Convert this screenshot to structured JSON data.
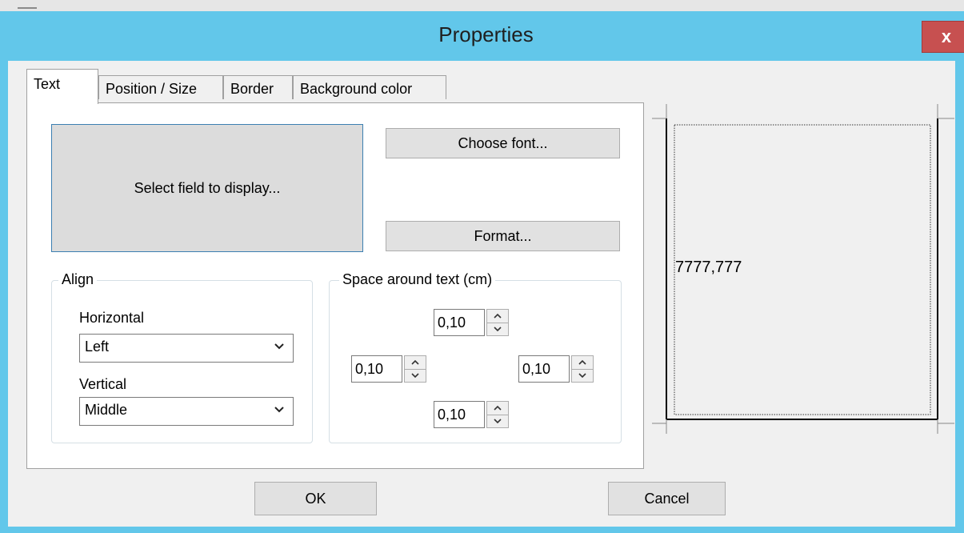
{
  "window": {
    "title": "Properties",
    "close_label": "x"
  },
  "tabs": [
    {
      "label": "Text",
      "active": true
    },
    {
      "label": "Position / Size",
      "active": false
    },
    {
      "label": "Border",
      "active": false
    },
    {
      "label": "Background color",
      "active": false
    }
  ],
  "text_tab": {
    "select_field_label": "Select field to display...",
    "choose_font_label": "Choose font...",
    "format_label": "Format...",
    "align": {
      "legend": "Align",
      "horizontal_label": "Horizontal",
      "horizontal_value": "Left",
      "vertical_label": "Vertical",
      "vertical_value": "Middle"
    },
    "space": {
      "legend": "Space around text (cm)",
      "top": "0,10",
      "left": "0,10",
      "right": "0,10",
      "bottom": "0,10"
    }
  },
  "preview": {
    "sample_text": "7777,777"
  },
  "footer": {
    "ok_label": "OK",
    "cancel_label": "Cancel"
  },
  "colors": {
    "titlebar": "#62c7ea",
    "close": "#c75050",
    "field_border": "#3c7fb1"
  }
}
